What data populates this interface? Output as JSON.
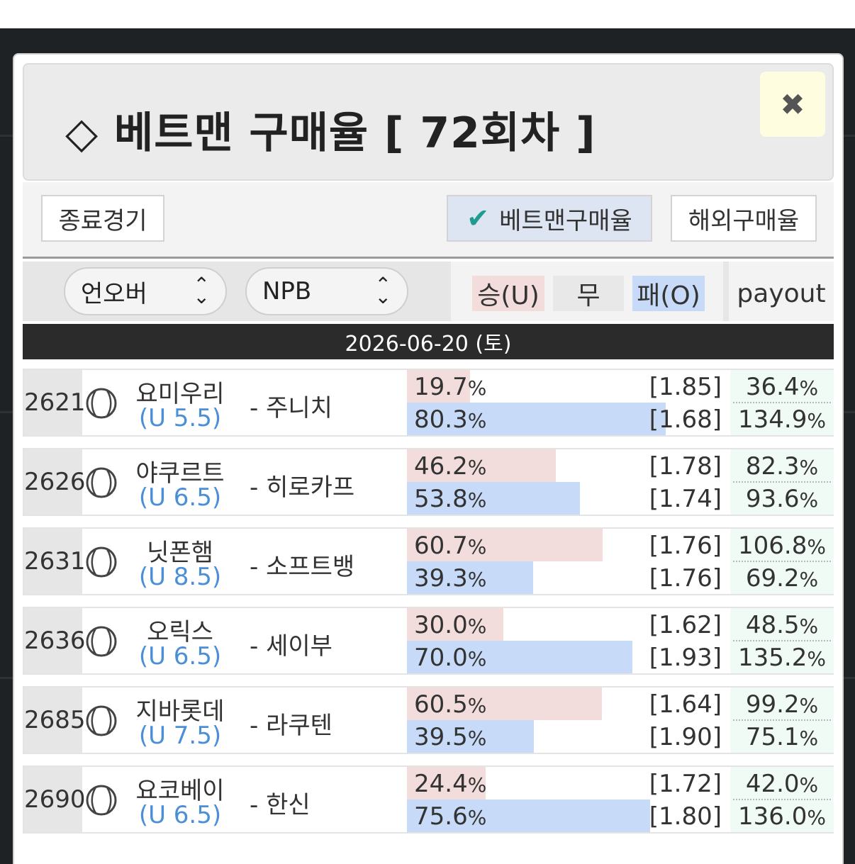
{
  "modal": {
    "title": "◇ 베트맨 구매율 [ 72회차 ]",
    "close_label": "✖"
  },
  "tabs": {
    "finished": "종료경기",
    "betman_check": "✔",
    "betman": "베트맨구매율",
    "overseas": "해외구매율"
  },
  "filters": {
    "type_value": "언오버",
    "league_value": "NPB",
    "legend_u": "승(U)",
    "legend_draw": "무",
    "legend_o": "패(O)",
    "payout_label": "payout"
  },
  "date": "2026-06-20 (토)",
  "matches": [
    {
      "num": "2621",
      "home": "요미우리",
      "line": "(U 5.5)",
      "away": "- 주니치",
      "u_pct": "19.7",
      "o_pct": "80.3",
      "u_odds": "[1.85]",
      "o_odds": "[1.68]",
      "u_pay": "36.4",
      "o_pay": "134.9",
      "u_share": 0.197,
      "o_share": 0.803
    },
    {
      "num": "2626",
      "home": "야쿠르트",
      "line": "(U 6.5)",
      "away": "- 히로카프",
      "u_pct": "46.2",
      "o_pct": "53.8",
      "u_odds": "[1.78]",
      "o_odds": "[1.74]",
      "u_pay": "82.3",
      "o_pay": "93.6",
      "u_share": 0.462,
      "o_share": 0.538
    },
    {
      "num": "2631",
      "home": "닛폰햄",
      "line": "(U 8.5)",
      "away": "- 소프트뱅",
      "u_pct": "60.7",
      "o_pct": "39.3",
      "u_odds": "[1.76]",
      "o_odds": "[1.76]",
      "u_pay": "106.8",
      "o_pay": "69.2",
      "u_share": 0.607,
      "o_share": 0.393
    },
    {
      "num": "2636",
      "home": "오릭스",
      "line": "(U 6.5)",
      "away": "- 세이부",
      "u_pct": "30.0",
      "o_pct": "70.0",
      "u_odds": "[1.62]",
      "o_odds": "[1.93]",
      "u_pay": "48.5",
      "o_pay": "135.2",
      "u_share": 0.3,
      "o_share": 0.7
    },
    {
      "num": "2685",
      "home": "지바롯데",
      "line": "(U 7.5)",
      "away": "- 라쿠텐",
      "u_pct": "60.5",
      "o_pct": "39.5",
      "u_odds": "[1.64]",
      "o_odds": "[1.90]",
      "u_pay": "99.2",
      "o_pay": "75.1",
      "u_share": 0.605,
      "o_share": 0.395
    },
    {
      "num": "2690",
      "home": "요코베이",
      "line": "(U 6.5)",
      "away": "- 한신",
      "u_pct": "24.4",
      "o_pct": "75.6",
      "u_odds": "[1.72]",
      "o_odds": "[1.80]",
      "u_pay": "42.0",
      "o_pay": "136.0",
      "u_share": 0.244,
      "o_share": 0.756
    }
  ],
  "colors": {
    "under_bar": "#f2dcdc",
    "over_bar": "#c7dbf8",
    "line_text": "#4a8fd8",
    "check": "#1e9c8f",
    "payout_bg": "#f0fbf6"
  },
  "icons": {
    "sport": "baseball-icon",
    "close": "close-icon",
    "select": "chevron-updown-icon"
  }
}
